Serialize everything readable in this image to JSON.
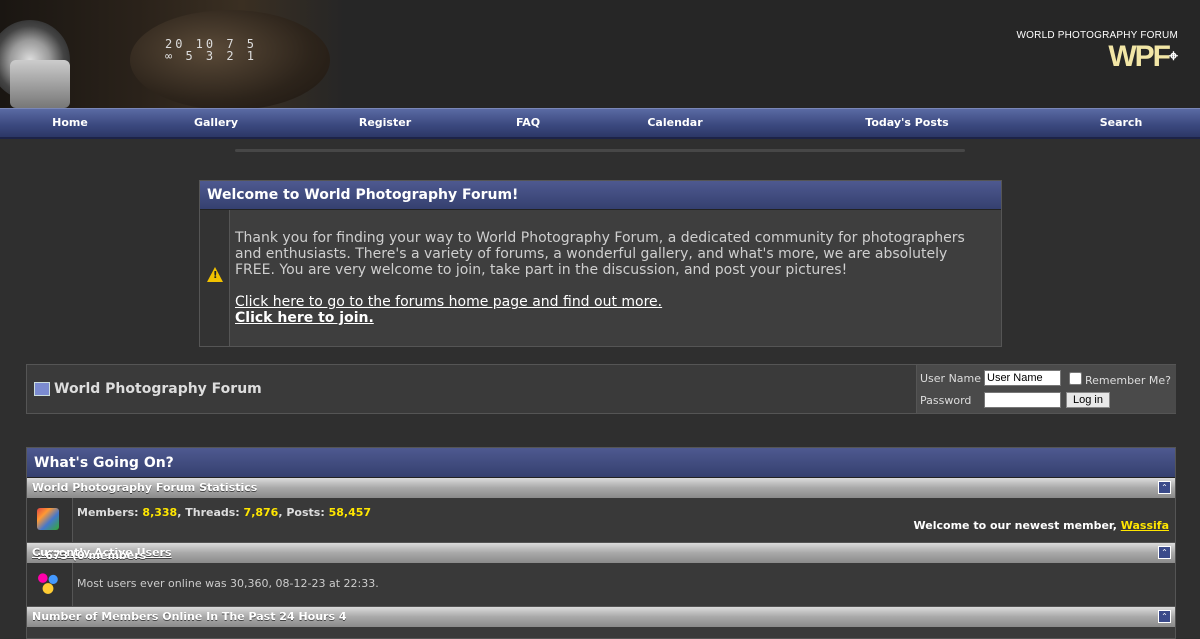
{
  "header": {
    "logo_top": "WORLD PHOTOGRAPHY FORUM",
    "logo_mark": "WPF",
    "dial_numbers_top": "20 10 7 5",
    "dial_numbers_bottom": "∞ 5 3 2 1"
  },
  "nav": [
    {
      "label": "Home"
    },
    {
      "label": "Gallery"
    },
    {
      "label": "Register"
    },
    {
      "label": "FAQ"
    },
    {
      "label": "Calendar"
    },
    {
      "label": "Today's Posts"
    },
    {
      "label": "Search"
    }
  ],
  "welcome": {
    "title": "Welcome to World Photography Forum!",
    "body": "Thank you for finding your way to World Photography Forum, a dedicated community for photographers and enthusiasts. There's a variety of forums, a wonderful gallery, and what's more, we are absolutely FREE. You are very welcome to join, take part in the discussion, and post your pictures!",
    "link_home": "Click here to go to the forums home page and find out more.",
    "link_join": "Click here to join.",
    "icon": "warning-icon"
  },
  "forumbar": {
    "title": "World Photography Forum",
    "icon": "forum-icon"
  },
  "login": {
    "username_label": "User Name",
    "username_value": "User Name",
    "password_label": "Password",
    "remember_label": "Remember Me?",
    "login_button": "Log in"
  },
  "whats_going_on": {
    "title": "What's Going On?",
    "stats_header": "World Photography Forum Statistics",
    "members_label": "Members:",
    "members_value": "8,338",
    "threads_label": "Threads:",
    "threads_value": "7,876",
    "posts_label": "Posts:",
    "posts_value": "58,457",
    "newest_prefix": "Welcome to our newest member,",
    "newest_member": "Wassifa",
    "active_link": "Currently Active Users",
    "active_rest": ": 673 (0 members and 673 guests)",
    "most_online": "Most users ever online was 30,360, 08-12-23 at 22:33.",
    "past24_header": "Number of Members Online In The Past 24 Hours 4"
  },
  "colors": {
    "navbar": "#3c4a80",
    "highlight": "#ffe600",
    "logo": "#f2e6a6"
  }
}
